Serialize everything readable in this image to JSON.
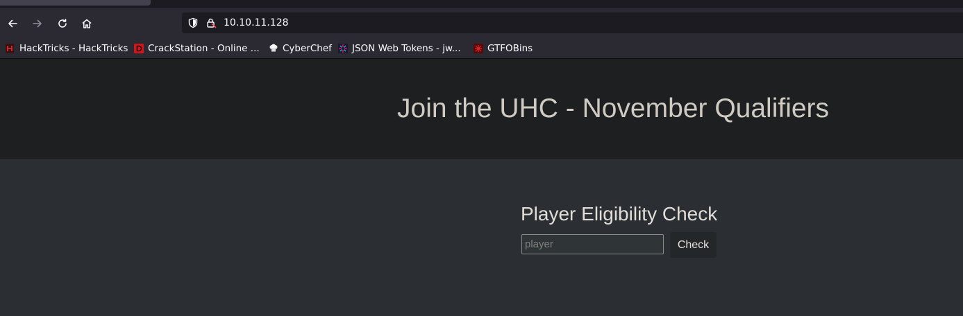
{
  "browser": {
    "address_bar": {
      "url": "10.10.11.128"
    },
    "bookmarks": [
      {
        "label": "HackTricks - HackTricks",
        "icon": "hacktricks-icon"
      },
      {
        "label": "CrackStation - Online ...",
        "icon": "crackstation-icon"
      },
      {
        "label": "CyberChef",
        "icon": "cyberchef-icon"
      },
      {
        "label": "JSON Web Tokens - jw...",
        "icon": "jwt-icon"
      },
      {
        "label": "GTFOBins",
        "icon": "gtfobins-icon"
      }
    ]
  },
  "page": {
    "hero_title": "Join the UHC - November Qualifiers",
    "check_heading": "Player Eligibility Check",
    "player_input": {
      "placeholder": "player",
      "value": ""
    },
    "check_button_label": "Check"
  },
  "colors": {
    "hero_background": "#1d1f20",
    "page_background": "#2b2f33",
    "browser_chrome": "#2b2a33",
    "url_field": "#1c1b22"
  }
}
